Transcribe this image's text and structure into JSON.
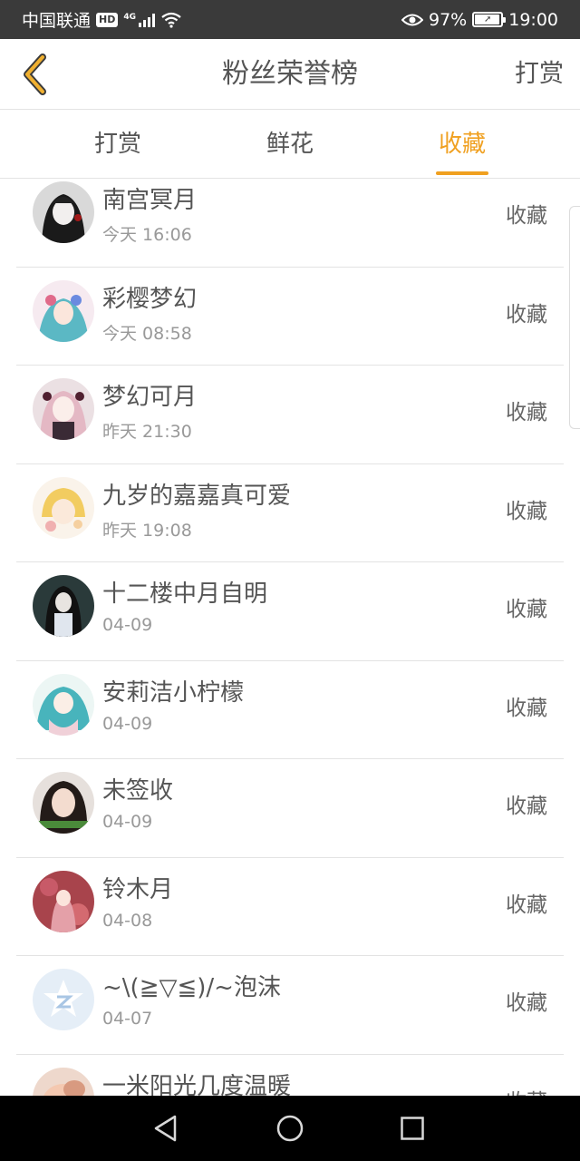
{
  "status_bar": {
    "carrier": "中国联通",
    "hd": "HD",
    "network": "4G",
    "battery": "97%",
    "battery_level": 0.97,
    "time": "19:00",
    "icons": [
      "hd-icon",
      "signal-icon",
      "wifi-icon",
      "eye-icon",
      "battery-icon"
    ]
  },
  "header": {
    "back_icon": "chevron-left-icon",
    "title": "粉丝荣誉榜",
    "action": "打赏"
  },
  "tabs": [
    {
      "label": "打赏",
      "active": false
    },
    {
      "label": "鲜花",
      "active": false
    },
    {
      "label": "收藏",
      "active": true
    }
  ],
  "accent_color": "#f0a020",
  "list": [
    {
      "name": "南宫冥月",
      "time": "今天 16:06",
      "action": "收藏",
      "avatar": "gothic-girl-avatar"
    },
    {
      "name": "彩樱梦幻",
      "time": "今天 08:58",
      "action": "收藏",
      "avatar": "miku-avatar"
    },
    {
      "name": "梦幻可月",
      "time": "昨天 21:30",
      "action": "收藏",
      "avatar": "pink-hair-girl-avatar"
    },
    {
      "name": "九岁的嘉嘉真可爱",
      "time": "昨天 19:08",
      "action": "收藏",
      "avatar": "blonde-boy-avatar"
    },
    {
      "name": "十二楼中月自明",
      "time": "04-09",
      "action": "收藏",
      "avatar": "dark-hair-girl-avatar"
    },
    {
      "name": "安莉洁小柠檬",
      "time": "04-09",
      "action": "收藏",
      "avatar": "miku-teal-avatar"
    },
    {
      "name": "未签收",
      "time": "04-09",
      "action": "收藏",
      "avatar": "photo-girl-avatar"
    },
    {
      "name": "铃木月",
      "time": "04-08",
      "action": "收藏",
      "avatar": "red-dress-avatar"
    },
    {
      "name": "~\\(≧▽≦)/~泡沫",
      "time": "04-07",
      "action": "收藏",
      "avatar": "default-qzone-avatar"
    },
    {
      "name": "一米阳光几度温暖",
      "time": "",
      "action": "收藏",
      "avatar": "blurred-photo-avatar"
    }
  ],
  "nav_bar": {
    "icons": [
      "back-triangle-icon",
      "home-circle-icon",
      "recents-square-icon"
    ]
  }
}
